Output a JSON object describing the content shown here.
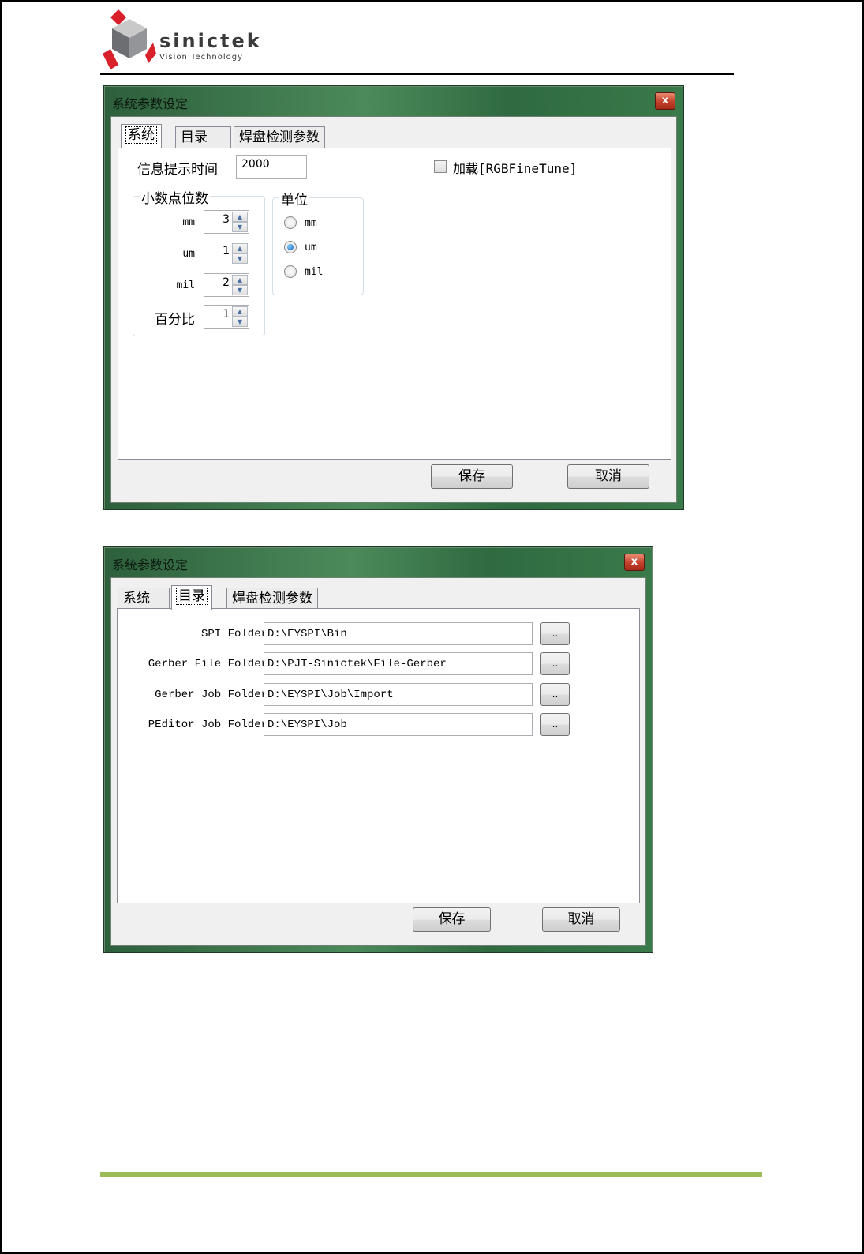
{
  "header": {
    "logo_text": "sinictek",
    "logo_subtitle": "Vision Technology"
  },
  "dialog1": {
    "title": "系统参数设定",
    "close_label": "x",
    "tabs": [
      "系统",
      "目录",
      "焊盘检测参数"
    ],
    "message_time_label": "信息提示时间",
    "message_time_value": "2000",
    "load_checkbox_label": "加载[RGBFineTune]",
    "decimal_group_title": "小数点位数",
    "decimal_rows": [
      {
        "label": "mm",
        "value": "3"
      },
      {
        "label": "um",
        "value": "1"
      },
      {
        "label": "mil",
        "value": "2"
      },
      {
        "label": "百分比",
        "value": "1"
      }
    ],
    "unit_group_title": "单位",
    "unit_options": [
      {
        "label": "mm",
        "selected": false
      },
      {
        "label": "um",
        "selected": true
      },
      {
        "label": "mil",
        "selected": false
      }
    ],
    "save_label": "保存",
    "cancel_label": "取消"
  },
  "dialog2": {
    "title": "系统参数设定",
    "close_label": "x",
    "tabs": [
      "系统",
      "目录",
      "焊盘检测参数"
    ],
    "folders": [
      {
        "label": "SPI Folder",
        "value": "D:\\EYSPI\\Bin",
        "browse": ".."
      },
      {
        "label": "Gerber File Folder",
        "value": "D:\\PJT-Sinictek\\File-Gerber",
        "browse": ".."
      },
      {
        "label": "Gerber Job Folder",
        "value": "D:\\EYSPI\\Job\\Import",
        "browse": ".."
      },
      {
        "label": "PEditor Job Folder",
        "value": "D:\\EYSPI\\Job",
        "browse": ".."
      }
    ],
    "save_label": "保存",
    "cancel_label": "取消"
  },
  "colors": {
    "footer_rule": "#9bbb59",
    "logo_red": "#d8212a",
    "logo_gray": "#6d6e71"
  }
}
